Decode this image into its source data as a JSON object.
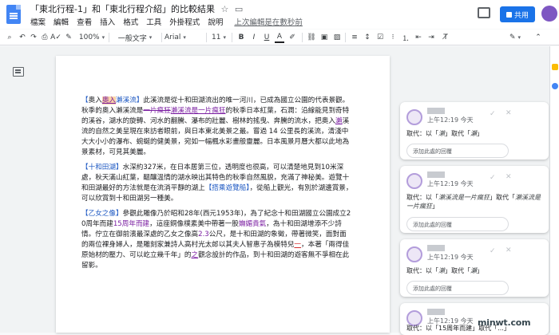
{
  "app": {
    "title": "「東北行程-1」和「東北行程介紹」的比較結果",
    "menu": [
      "檔案",
      "編輯",
      "查看",
      "插入",
      "格式",
      "工具",
      "外掛程式",
      "說明"
    ],
    "last_edit": "上次編輯是在數秒前",
    "share_label": "共用"
  },
  "toolbar": {
    "zoom": "100%",
    "style": "一般文字",
    "font": "Arial",
    "size": "11"
  },
  "document": {
    "p1": {
      "open": "【",
      "ins1": "奧入",
      "rest_title": "瀨溪流",
      "close": "】",
      "t1": "此溪流是從十和田湖流出的唯一河川，已成為國立公園的代表景觀。秋季的奧入瀨溪流是",
      "del1": "一片瘋狂",
      "ins2": "瀨溪流是一片瘋狂",
      "t2": "的秋季日本紅葉，",
      "t3": "石澗：沿線能見到奇特的溪谷，",
      "t4": "湖水的旋轉、河水的翻騰、瀑布的壯麗、樹林的搖曳、奔騰的流水，把奧入",
      "ins3": "瀨",
      "t5": "溪流的自然之美呈現在來訪者眼前，與日本東北美景之最。嘗過 14 公里長的溪流，清淺中大大小小的瀑布、蜿蜒的健美景，宛如一幅楓水彩畫般靈麗。日本風景月曆大都以此地為景素材，可見其美麗。"
    },
    "p2": {
      "open": "【",
      "title": "十和田湖",
      "close": "】",
      "t1": "水深約327米，在日本居第三位，透明度也很高，可以清楚地見到10米深處，秋天滿山紅葉，醞釀溫情的湖水映出其特色的秋季自然風貌，充滿了神秘美。遊覽十和田湖最好的方法就是在流淌平靜的湖上",
      "link": "【搭乘遊覽船】",
      "t2": "，從船上觀光，有別於湖邊賞景，可以欣賞到十和田湖另一種美。"
    },
    "p3": {
      "open": "【",
      "title": "乙女之像",
      "close": "】",
      "t1": "參觀此雕像乃於昭和28年(西元1953年)，為了紀念十和田湖國立公園成立20周年而建",
      "ins1": "15周年而建",
      "t2": "，這座銅像樸素美中帶著一股",
      "ins2": "嫵媚貴氣",
      "t3": "，為十和田湖增添不少詩情。佇立在御前濱最深處的乙女之像高",
      "num": "2.3",
      "t4": "公尺，是十和田湖的象徵，帶著微笑，面對面的兩位裸身婦人，是雕刻家兼詩人高村光太郎以其夫人智惠子為模特兒",
      "ins3": "一",
      "t5": "，本著「兩得佳原始材的壓力、可以屹立幾千年」的",
      "ins4": "之",
      "t6": "觀念設計的作品，到十和田湖的遊客無不爭相在此留影。"
    }
  },
  "comments": [
    {
      "time": "上午12:19 今天",
      "body": "取代：以「",
      "old": "瀨",
      "mid": "」取代「",
      "new": "瀬",
      "tail": "」",
      "reply": "添加此處的回覆"
    },
    {
      "time": "上午12:19 今天",
      "body": "取代：以「",
      "old": "瀨溪流是一片瘋狂",
      "mid": "」取代「",
      "new": "瀨溪流是一片瘋狂",
      "tail": "」",
      "reply": "添加此處的回覆"
    },
    {
      "time": "上午12:19 今天",
      "body": "取代：以「",
      "old": "瀨",
      "mid": "」取代「",
      "new": "瀬",
      "tail": "」",
      "reply": "添加此處的回覆"
    },
    {
      "time": "上午12:19 今天",
      "body": "取代：以「15周年而建」取代「...」"
    }
  ],
  "watermark": "梅問題·教學網",
  "watermark_url": "minwt.com"
}
